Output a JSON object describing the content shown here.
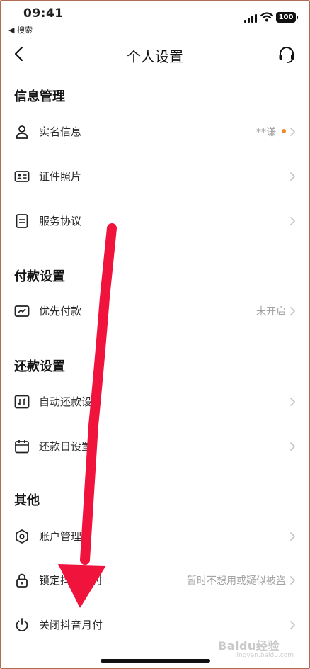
{
  "status_bar": {
    "time": "09:41",
    "back_app": "◀ 搜索",
    "battery": "100"
  },
  "nav": {
    "title": "个人设置"
  },
  "sections": [
    {
      "title": "信息管理",
      "items": [
        {
          "label": "实名信息",
          "value": "**谦",
          "dot": true,
          "icon": "person-icon"
        },
        {
          "label": "证件照片",
          "value": "",
          "icon": "id-card-icon"
        },
        {
          "label": "服务协议",
          "value": "",
          "icon": "document-icon"
        }
      ]
    },
    {
      "title": "付款设置",
      "items": [
        {
          "label": "优先付款",
          "value": "未开启",
          "icon": "priority-pay-icon"
        }
      ]
    },
    {
      "title": "还款设置",
      "items": [
        {
          "label": "自动还款设",
          "value": "",
          "icon": "auto-repay-icon"
        },
        {
          "label": "还款日设置",
          "value": "",
          "icon": "calendar-icon"
        }
      ]
    },
    {
      "title": "其他",
      "items": [
        {
          "label": "账户管理",
          "value": "",
          "icon": "account-icon"
        },
        {
          "label": "锁定抖音月付",
          "value": "暂时不想用或疑似被盗",
          "icon": "lock-icon"
        },
        {
          "label": "关闭抖音月付",
          "value": "",
          "icon": "power-icon"
        }
      ]
    }
  ],
  "watermark": {
    "brand": "Baidu经验",
    "sub": "jingyan.baidu.com"
  },
  "colors": {
    "accent_dot": "#f28a2d",
    "annotation_arrow": "#f0143c"
  }
}
